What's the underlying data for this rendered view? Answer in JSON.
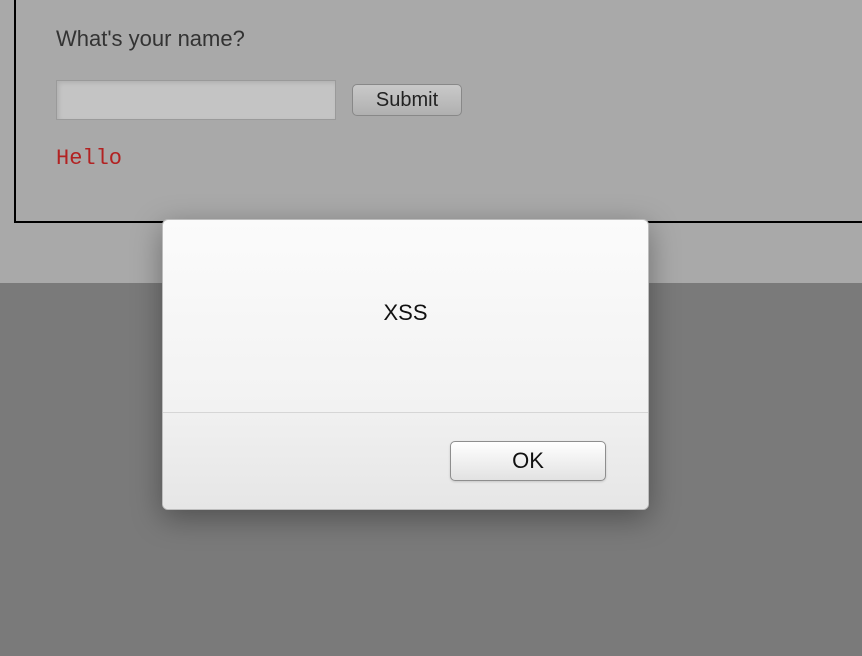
{
  "form": {
    "prompt": "What's your name?",
    "input_value": "",
    "submit_label": "Submit"
  },
  "output": {
    "greeting": "Hello"
  },
  "dialog": {
    "message": "XSS",
    "ok_label": "OK"
  },
  "colors": {
    "greeting_color": "#b22222"
  }
}
